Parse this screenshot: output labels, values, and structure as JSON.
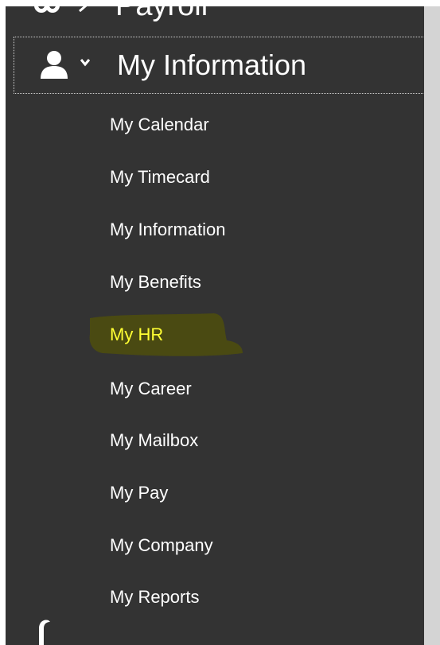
{
  "sidebar": {
    "collapsed_section_above": {
      "label": "Payroll",
      "icon": "money-icon",
      "chevron": "chevron-right-icon"
    },
    "expanded_section": {
      "label": "My Information",
      "icon": "user-icon",
      "chevron": "chevron-down-icon"
    },
    "items": [
      {
        "label": "My Calendar"
      },
      {
        "label": "My Timecard"
      },
      {
        "label": "My Information"
      },
      {
        "label": "My Benefits"
      },
      {
        "label": "My HR",
        "highlighted": true
      },
      {
        "label": "My Career"
      },
      {
        "label": "My Mailbox"
      },
      {
        "label": "My Pay"
      },
      {
        "label": "My Company"
      },
      {
        "label": "My Reports"
      }
    ],
    "colors": {
      "background": "#333333",
      "text": "#ffffff",
      "highlight_text": "#ffff33",
      "highlight_marker": "#4a4a12",
      "scrollbar": "#d4d4d4"
    }
  }
}
